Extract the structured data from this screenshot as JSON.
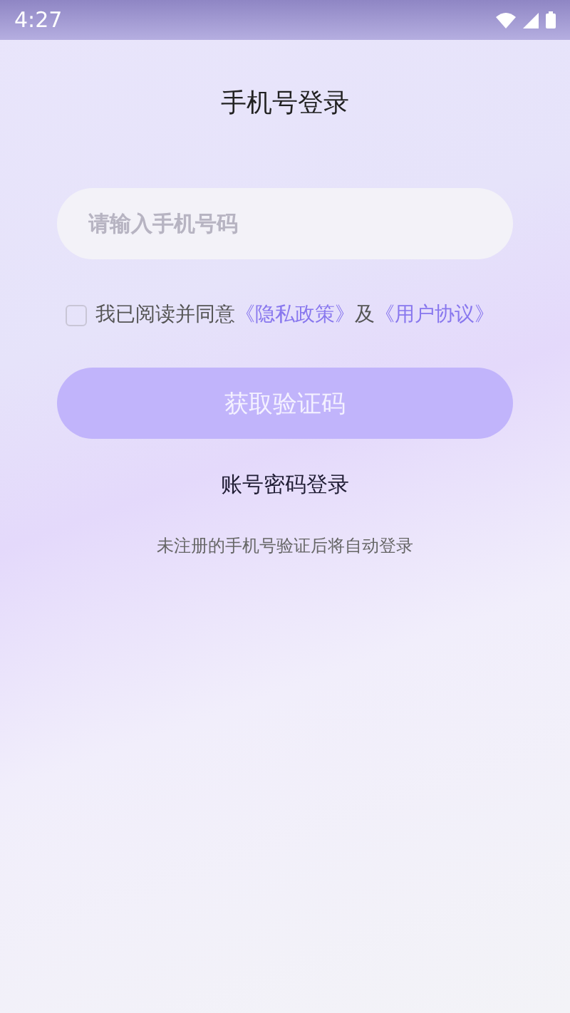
{
  "status_bar": {
    "time": "4:27"
  },
  "title": "手机号登录",
  "phone_field": {
    "placeholder": "请输入手机号码"
  },
  "agreement": {
    "checked": false,
    "text": "我已阅读并同意",
    "link_1": "《隐私政策》",
    "joiner": "及",
    "link_2": "《用户协议》"
  },
  "get_code_button": {
    "label": "获取验证码",
    "disabled": true
  },
  "password_login": "账号密码登录",
  "note": "未注册的手机号验证后将自动登录"
}
